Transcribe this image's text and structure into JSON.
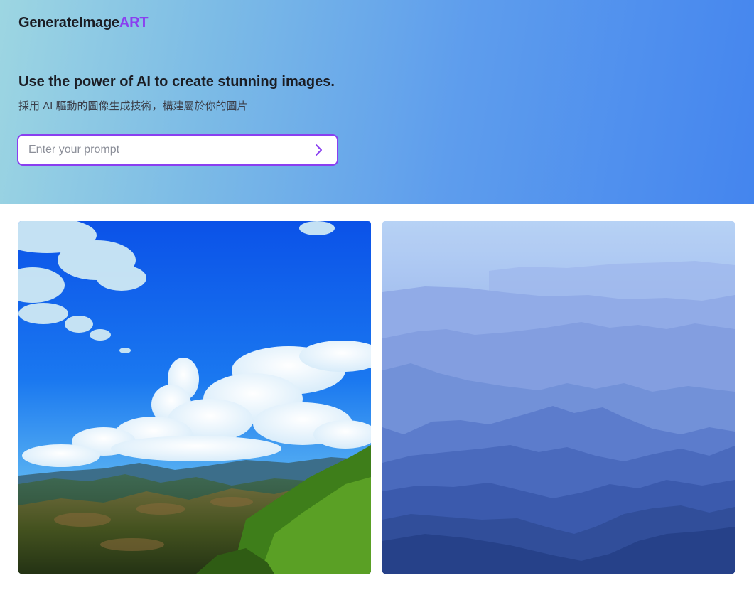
{
  "header": {
    "logo_main": "GenerateImage",
    "logo_accent": "ART",
    "headline": "Use the power of AI to create stunning images.",
    "subheadline": "採用 AI 驅動的圖像生成技術，構建屬於你的圖片"
  },
  "prompt": {
    "placeholder": "Enter your prompt",
    "value": ""
  },
  "colors": {
    "accent": "#8a3ff0",
    "hero_gradient_start": "#9dd6e2",
    "hero_gradient_end": "#4485ee"
  },
  "icons": {
    "submit": "chevron-right-icon"
  },
  "gallery": {
    "images": [
      {
        "subject": "sky-clouds-mountains"
      },
      {
        "subject": "misty-blue-mountains"
      }
    ]
  }
}
